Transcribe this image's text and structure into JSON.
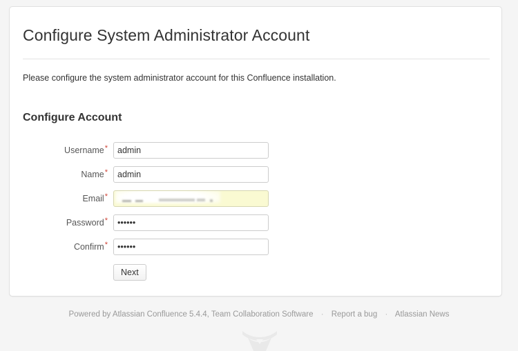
{
  "page": {
    "title": "Configure System Administrator Account",
    "intro": "Please configure the system administrator account for this Confluence installation.",
    "section_heading": "Configure Account",
    "background_color": "#f5f5f5",
    "card_color": "#ffffff"
  },
  "form": {
    "required_marker": "*",
    "required_marker_color": "#d04437",
    "fields": [
      {
        "label": "Username",
        "value": "admin",
        "type": "text",
        "autofilled": false
      },
      {
        "label": "Name",
        "value": "admin",
        "type": "text",
        "autofilled": false
      },
      {
        "label": "Email",
        "value": "",
        "type": "text",
        "autofilled": true
      },
      {
        "label": "Password",
        "value": "••••••",
        "type": "password",
        "autofilled": false
      },
      {
        "label": "Confirm",
        "value": "••••••",
        "type": "password",
        "autofilled": false
      }
    ],
    "submit_label": "Next",
    "autofill_color": "#fafad2"
  },
  "footer": {
    "powered_by": "Powered by Atlassian Confluence 5.4.4, Team Collaboration Software",
    "separator": "·",
    "report_bug": "Report a bug",
    "atlassian_news": "Atlassian News"
  },
  "watermark": {
    "icon": "confluence-logo-icon",
    "color": "#e8e8e8"
  }
}
